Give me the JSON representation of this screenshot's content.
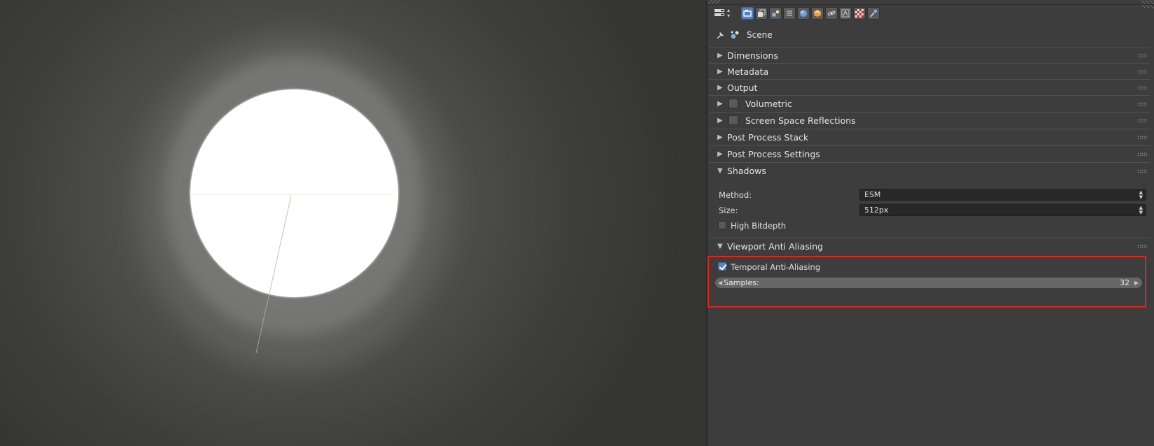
{
  "properties": {
    "context": {
      "label": "Scene"
    },
    "toolbar_icons": [
      "render-icon",
      "render-layers-icon",
      "scene-icon",
      "world-icon",
      "object-icon",
      "constraints-icon",
      "modifiers-icon",
      "material-icon",
      "texture-icon",
      "particles-icon",
      "physics-icon"
    ],
    "panels": {
      "dimensions": "Dimensions",
      "metadata": "Metadata",
      "output": "Output",
      "volumetric": "Volumetric",
      "ssr": "Screen Space Reflections",
      "post_process_stack": "Post Process Stack",
      "post_process_settings": "Post Process Settings",
      "shadows": "Shadows",
      "viewport_aa": "Viewport Anti Aliasing"
    },
    "shadows": {
      "method_label": "Method:",
      "method_value": "ESM",
      "size_label": "Size:",
      "size_value": "512px",
      "high_bitdepth_label": "High Bitdepth",
      "high_bitdepth_checked": false
    },
    "viewport_aa": {
      "taa_label": "Temporal Anti-Aliasing",
      "taa_checked": true,
      "samples_label": "Samples:",
      "samples_value": "32"
    }
  },
  "colors": {
    "panel_bg": "#3d3d3d",
    "accent_blue": "#5680c2",
    "highlight_red": "#e0251b"
  }
}
